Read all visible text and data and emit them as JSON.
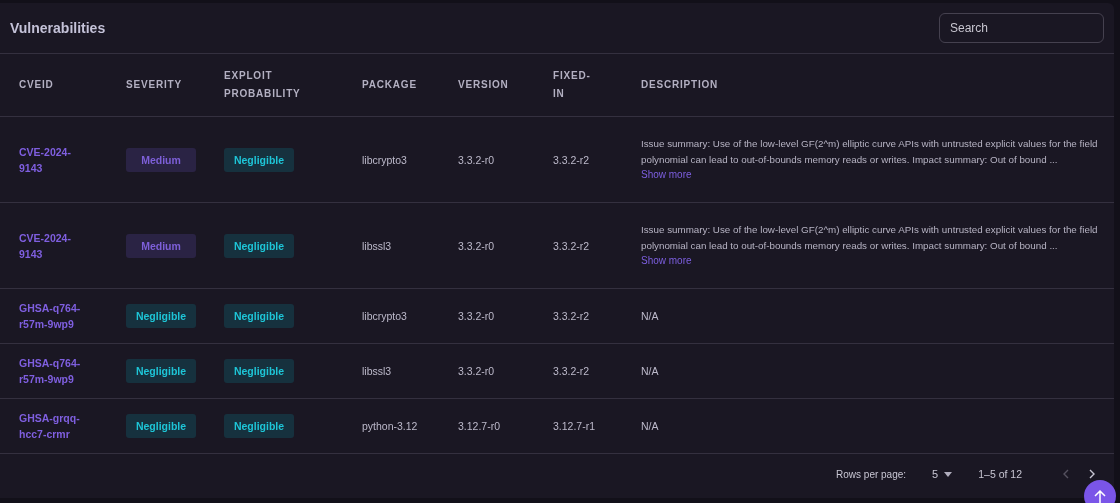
{
  "title": "Vulnerabilities",
  "search": {
    "placeholder": "Search"
  },
  "table": {
    "columns": [
      "CVEID",
      "SEVERITY",
      "EXPLOIT PROBABILITY",
      "PACKAGE",
      "VERSION",
      "FIXED-IN",
      "DESCRIPTION"
    ],
    "rows": [
      {
        "cveid": "CVE-2024-9143",
        "severity": {
          "label": "Medium",
          "kind": "medium"
        },
        "exploit": {
          "label": "Negligible",
          "kind": "negligible"
        },
        "package": "libcrypto3",
        "version": "3.3.2-r0",
        "fixed_in": "3.3.2-r2",
        "description": "Issue summary: Use of the low-level GF(2^m) elliptic curve APIs with untrusted explicit values for the field polynomial can lead to out-of-bounds memory reads or writes. Impact summary: Out of bound ...",
        "show_more": "Show more"
      },
      {
        "cveid": "CVE-2024-9143",
        "severity": {
          "label": "Medium",
          "kind": "medium"
        },
        "exploit": {
          "label": "Negligible",
          "kind": "negligible"
        },
        "package": "libssl3",
        "version": "3.3.2-r0",
        "fixed_in": "3.3.2-r2",
        "description": "Issue summary: Use of the low-level GF(2^m) elliptic curve APIs with untrusted explicit values for the field polynomial can lead to out-of-bounds memory reads or writes. Impact summary: Out of bound ...",
        "show_more": "Show more"
      },
      {
        "cveid": "GHSA-q764-r57m-9wp9",
        "severity": {
          "label": "Negligible",
          "kind": "negligible"
        },
        "exploit": {
          "label": "Negligible",
          "kind": "negligible"
        },
        "package": "libcrypto3",
        "version": "3.3.2-r0",
        "fixed_in": "3.3.2-r2",
        "description": "N/A"
      },
      {
        "cveid": "GHSA-q764-r57m-9wp9",
        "severity": {
          "label": "Negligible",
          "kind": "negligible"
        },
        "exploit": {
          "label": "Negligible",
          "kind": "negligible"
        },
        "package": "libssl3",
        "version": "3.3.2-r0",
        "fixed_in": "3.3.2-r2",
        "description": "N/A"
      },
      {
        "cveid": "GHSA-grqq-hcc7-crmr",
        "severity": {
          "label": "Negligible",
          "kind": "negligible"
        },
        "exploit": {
          "label": "Negligible",
          "kind": "negligible"
        },
        "package": "python-3.12",
        "version": "3.12.7-r0",
        "fixed_in": "3.12.7-r1",
        "description": "N/A"
      }
    ]
  },
  "pagination": {
    "rows_per_page_label": "Rows per page:",
    "rows_per_page": "5",
    "range": "1–5 of 12",
    "prev": {
      "disabled": true
    },
    "next": {
      "disabled": false
    }
  }
}
